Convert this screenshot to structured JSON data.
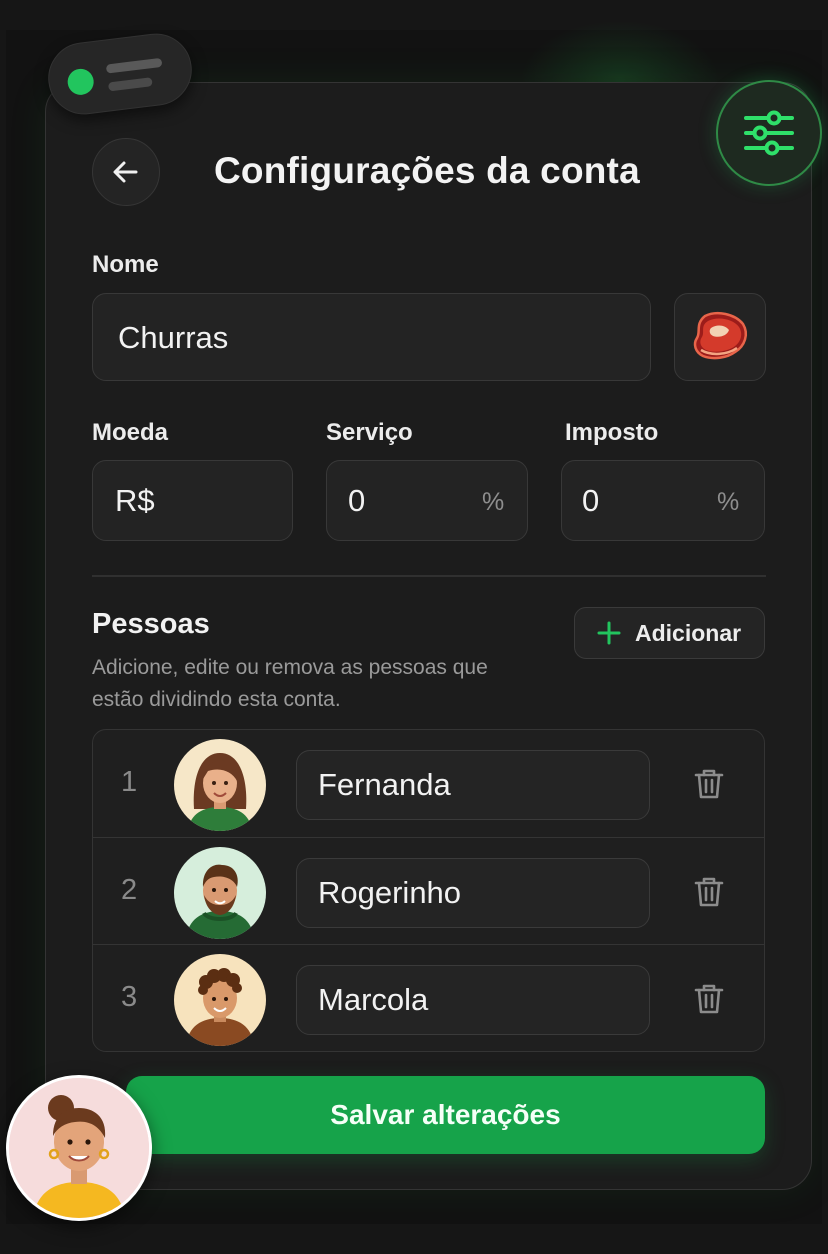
{
  "colors": {
    "accent": "#22c55e",
    "save_button": "#16a34a",
    "card_bg": "#1c1c1c",
    "field_bg": "#232323"
  },
  "header": {
    "title": "Configurações da conta",
    "back_icon": "arrow-left-icon",
    "settings_icon": "sliders-icon"
  },
  "form": {
    "name_label": "Nome",
    "name_value": "Churras",
    "category_icon": "steak-icon",
    "currency_label": "Moeda",
    "currency_value": "R$",
    "service_label": "Serviço",
    "service_value": "0",
    "service_unit": "%",
    "tax_label": "Imposto",
    "tax_value": "0",
    "tax_unit": "%"
  },
  "people": {
    "title": "Pessoas",
    "description": "Adicione, edite ou remova as pessoas que estão dividindo esta conta.",
    "add_label": "Adicionar",
    "items": [
      {
        "index": "1",
        "name": "Fernanda"
      },
      {
        "index": "2",
        "name": "Rogerinho"
      },
      {
        "index": "3",
        "name": "Marcola"
      }
    ]
  },
  "actions": {
    "save_label": "Salvar alterações"
  }
}
